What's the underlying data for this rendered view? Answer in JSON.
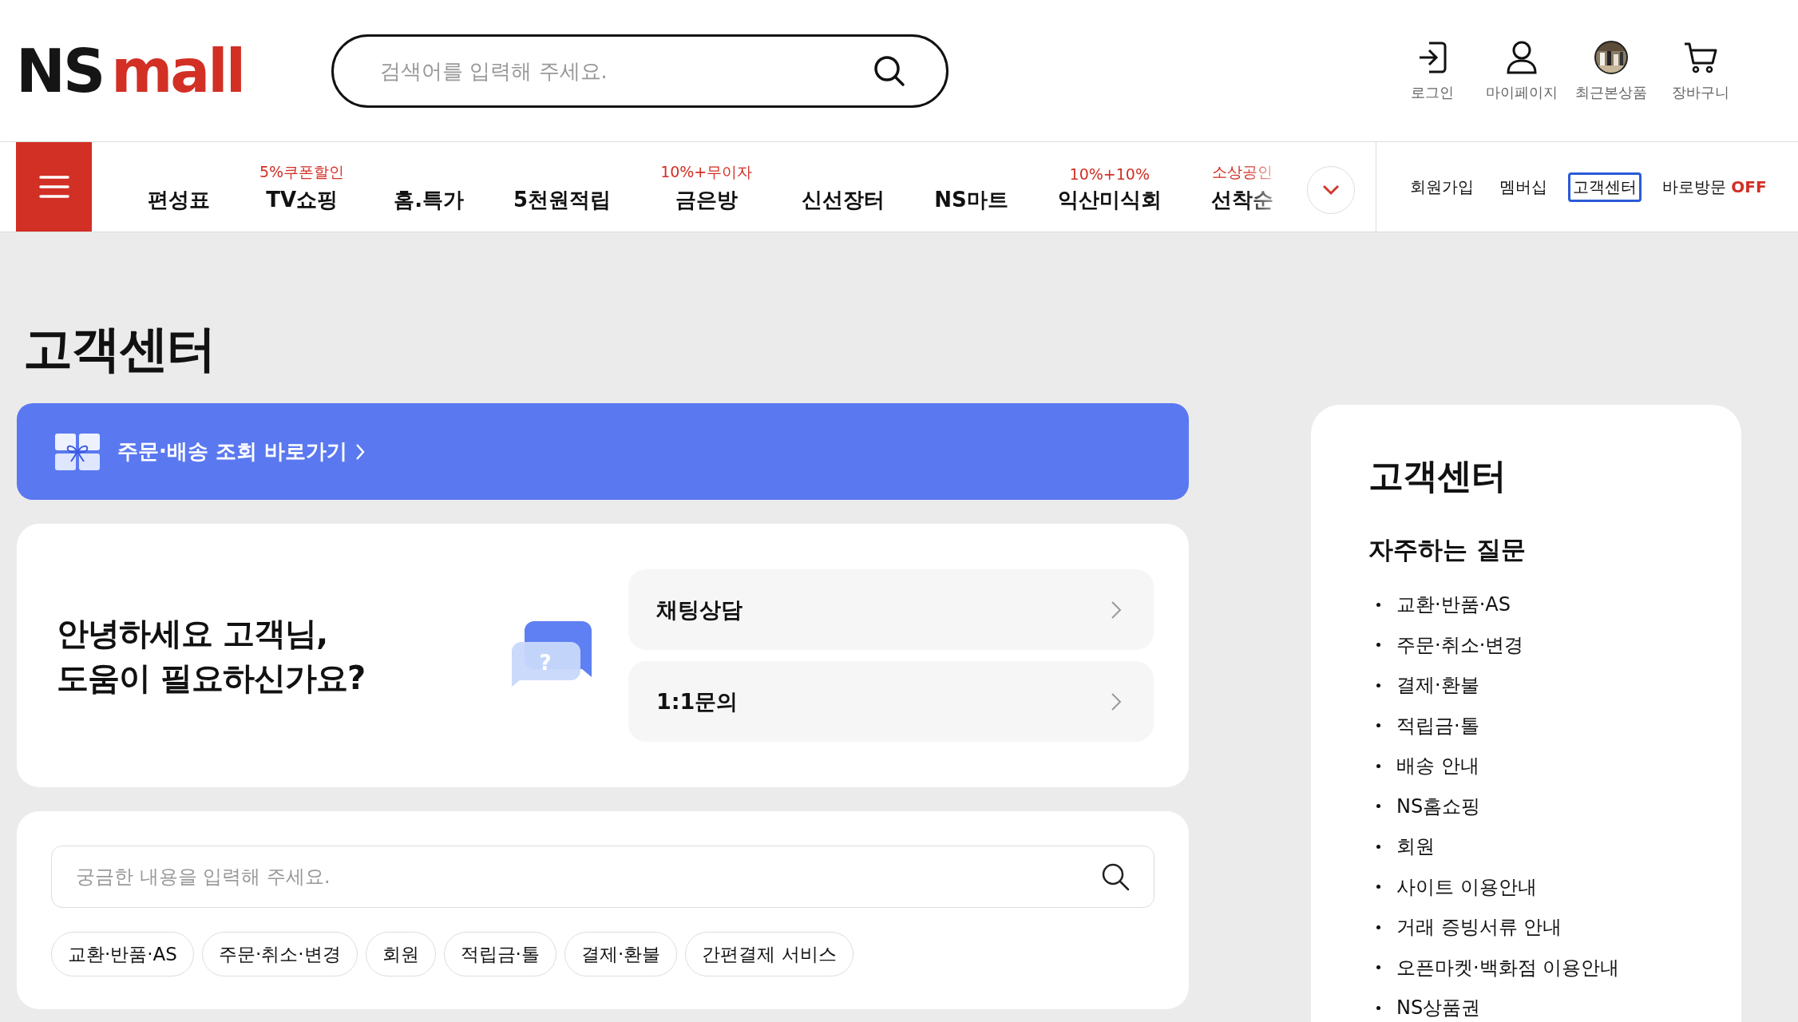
{
  "header": {
    "logo": {
      "first": "NS",
      "second": "mall"
    },
    "search": {
      "placeholder": "검색어를 입력해 주세요."
    },
    "utilities": [
      {
        "kind": "login",
        "label": "로그인"
      },
      {
        "kind": "recent_user",
        "label": "마이페이지"
      },
      {
        "kind": "recent",
        "label": "최근본상품"
      },
      {
        "kind": "cart",
        "label": "장바구니"
      }
    ]
  },
  "nav": {
    "items": [
      {
        "label": "편성표"
      },
      {
        "label": "TV쇼핑",
        "badge": "5%쿠폰할인"
      },
      {
        "label": "홈.특가"
      },
      {
        "label": "5천원적립"
      },
      {
        "label": "금은방",
        "badge": "10%+무이자"
      },
      {
        "label": "신선장터"
      },
      {
        "label": "NS마트"
      },
      {
        "label": "익산미식회",
        "badge": "10%+10%"
      },
      {
        "label": "선착순",
        "badge": "소상공인",
        "faded": true
      }
    ],
    "member_links": [
      {
        "label": "회원가입",
        "selected": false
      },
      {
        "label": "멤버십",
        "selected": false
      },
      {
        "label": "고객센터",
        "selected": true
      }
    ],
    "quick_visit": {
      "label": "바로방문",
      "state": "OFF"
    }
  },
  "page_title": "고객센터",
  "order_banner": "주문·배송 조회 바로가기",
  "help": {
    "icon_mark": "?",
    "greeting": "안녕하세요 고객님,\n도움이 필요하신가요?",
    "options": [
      {
        "label": "채팅상담"
      },
      {
        "label": "1:1문의"
      }
    ]
  },
  "faq_search": {
    "placeholder": "궁금한 내용을 입력해 주세요.",
    "chips": [
      "교환·반품·AS",
      "주문·취소·변경",
      "회원",
      "적립금·톨",
      "결제·환불",
      "간편결제 서비스"
    ]
  },
  "sidebar": {
    "title": "고객센터",
    "faq_heading": "자주하는 질문",
    "items": [
      "교환·반품·AS",
      "주문·취소·변경",
      "결제·환불",
      "적립금·톨",
      "배송 안내",
      "NS홈쇼핑",
      "회원",
      "사이트 이용안내",
      "거래 증빙서류 안내",
      "오픈마켓·백화점 이용안내",
      "NS상품권"
    ]
  }
}
